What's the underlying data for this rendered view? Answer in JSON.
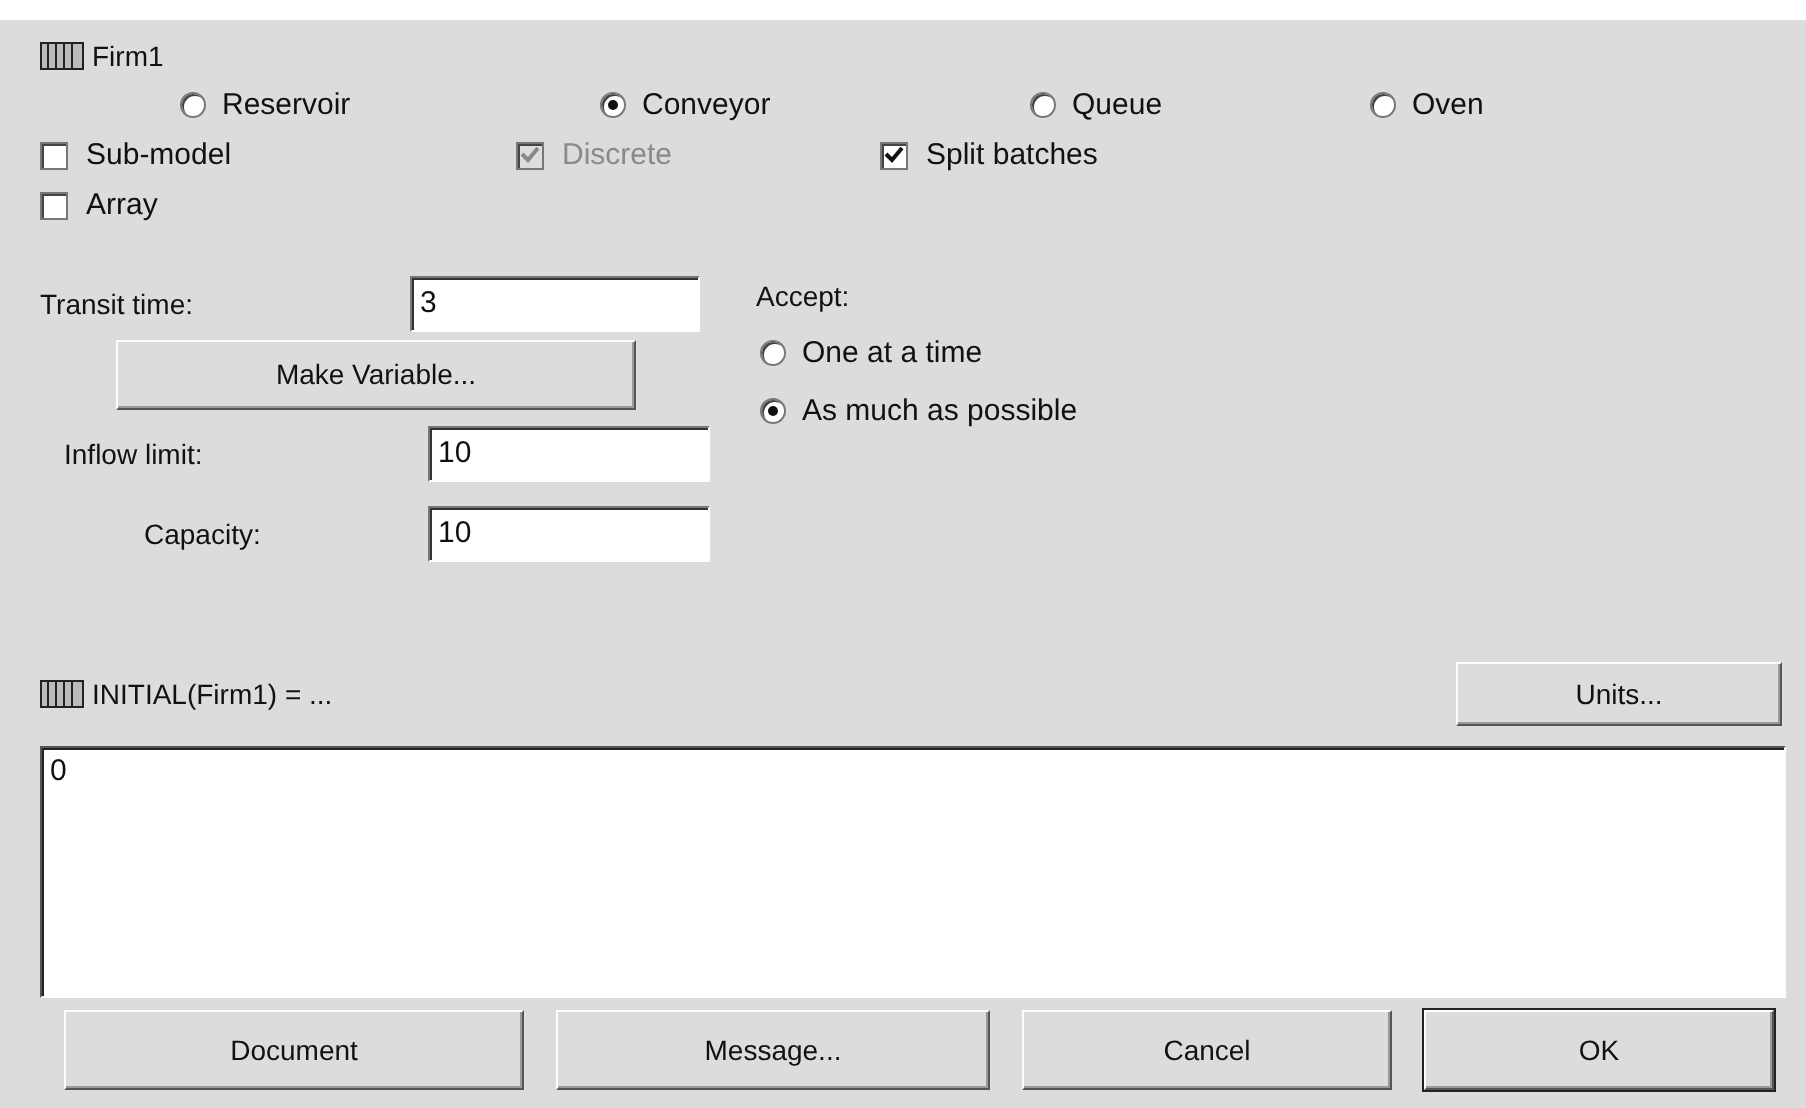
{
  "variable": {
    "name": "Firm1"
  },
  "types": [
    {
      "label": "Reservoir",
      "selected": false
    },
    {
      "label": "Conveyor",
      "selected": true
    },
    {
      "label": "Queue",
      "selected": false
    },
    {
      "label": "Oven",
      "selected": false
    }
  ],
  "options": [
    {
      "label": "Sub-model",
      "checked": false,
      "disabled": false
    },
    {
      "label": "Discrete",
      "checked": true,
      "disabled": true
    },
    {
      "label": "Split batches",
      "checked": true,
      "disabled": false
    },
    {
      "label": "Array",
      "checked": false,
      "disabled": false
    }
  ],
  "transit_time": {
    "label": "Transit time:",
    "value": "3"
  },
  "make_variable_button": "Make Variable...",
  "inflow_limit": {
    "label": "Inflow limit:",
    "value": "10"
  },
  "capacity": {
    "label": "Capacity:",
    "value": "10"
  },
  "accept": {
    "label": "Accept:",
    "options": [
      {
        "label": "One at a time",
        "selected": false
      },
      {
        "label": "As much as possible",
        "selected": true
      }
    ]
  },
  "equation": {
    "label": "INITIAL(Firm1) = ...",
    "value": "0"
  },
  "units_button": "Units...",
  "buttons": [
    {
      "label": "Document",
      "default": false
    },
    {
      "label": "Message...",
      "default": false
    },
    {
      "label": "Cancel",
      "default": false
    },
    {
      "label": "OK",
      "default": true
    }
  ]
}
